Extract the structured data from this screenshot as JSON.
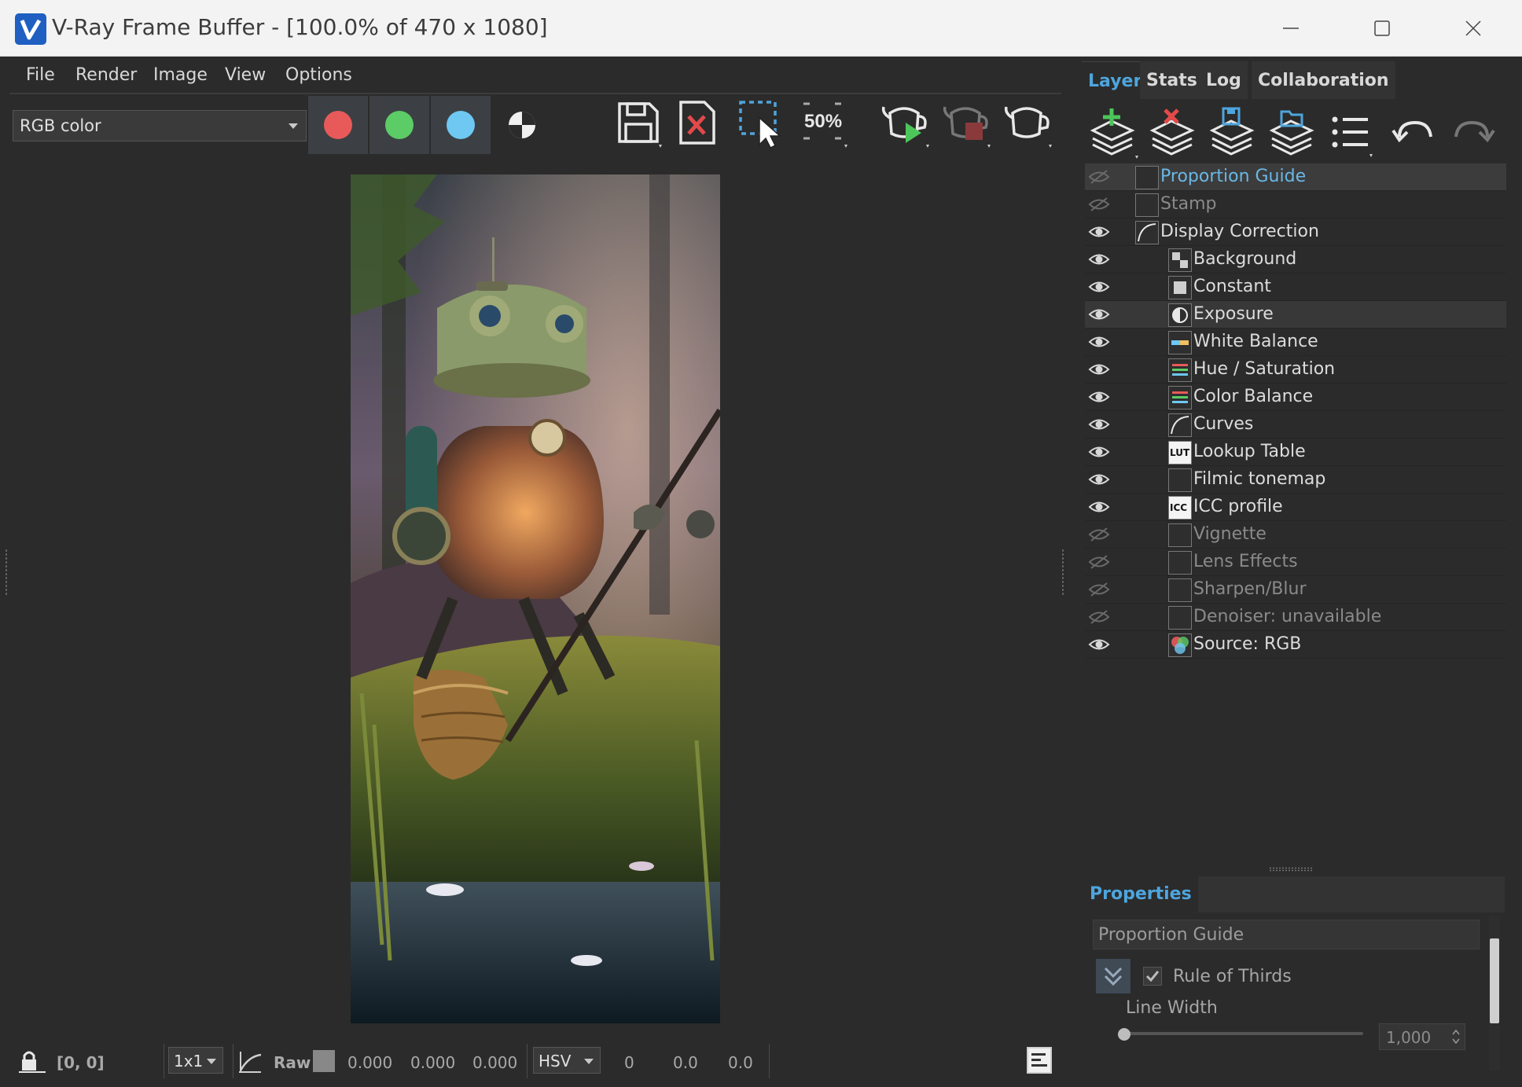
{
  "window": {
    "title": "V-Ray Frame Buffer - [100.0% of 470 x 1080]"
  },
  "menu": [
    "File",
    "Render",
    "Image",
    "View",
    "Options"
  ],
  "toolbar": {
    "channel": "RGB color",
    "channel_swatches": [
      {
        "name": "red-channel",
        "color": "#e85a5a"
      },
      {
        "name": "green-channel",
        "color": "#5ccc66"
      },
      {
        "name": "blue-channel",
        "color": "#6ec8f2"
      }
    ],
    "zoom_label": "50%"
  },
  "tabs": [
    "Layers",
    "Stats",
    "Log",
    "Collaboration"
  ],
  "active_tab": "Layers",
  "layers": [
    {
      "name": "Proportion Guide",
      "visible": false,
      "indent": 0,
      "selected": true,
      "icon": "proportion-guide-icon"
    },
    {
      "name": "Stamp",
      "visible": false,
      "indent": 0,
      "icon": "stamp-icon"
    },
    {
      "name": "Display Correction",
      "visible": true,
      "indent": 0,
      "icon": "display-correction-icon"
    },
    {
      "name": "Background",
      "visible": true,
      "indent": 1,
      "icon": "background-icon"
    },
    {
      "name": "Constant",
      "visible": true,
      "indent": 1,
      "icon": "constant-icon"
    },
    {
      "name": "Exposure",
      "visible": true,
      "indent": 1,
      "hover": true,
      "icon": "exposure-icon"
    },
    {
      "name": "White Balance",
      "visible": true,
      "indent": 1,
      "icon": "white-balance-icon"
    },
    {
      "name": "Hue / Saturation",
      "visible": true,
      "indent": 1,
      "icon": "hue-saturation-icon"
    },
    {
      "name": "Color Balance",
      "visible": true,
      "indent": 1,
      "icon": "color-balance-icon"
    },
    {
      "name": "Curves",
      "visible": true,
      "indent": 1,
      "icon": "curves-icon"
    },
    {
      "name": "Lookup Table",
      "visible": true,
      "indent": 1,
      "icon": "lut-icon",
      "icon_text": "LUT"
    },
    {
      "name": "Filmic tonemap",
      "visible": true,
      "indent": 1,
      "icon": "filmic-tonemap-icon"
    },
    {
      "name": "ICC profile",
      "visible": true,
      "indent": 1,
      "icon": "icc-icon",
      "icon_text": "ICC"
    },
    {
      "name": "Vignette",
      "visible": false,
      "indent": 1,
      "icon": "vignette-icon"
    },
    {
      "name": "Lens Effects",
      "visible": false,
      "indent": 1,
      "icon": "lens-effects-icon"
    },
    {
      "name": "Sharpen/Blur",
      "visible": false,
      "indent": 1,
      "icon": "sharpen-blur-icon"
    },
    {
      "name": "Denoiser: unavailable",
      "visible": false,
      "indent": 1,
      "icon": "denoiser-icon"
    },
    {
      "name": "Source: RGB",
      "visible": true,
      "indent": 1,
      "icon": "source-rgb-icon"
    }
  ],
  "properties": {
    "header": "Properties",
    "title": "Proportion Guide",
    "rule_of_thirds": {
      "label": "Rule of Thirds",
      "checked": true
    },
    "line_width": {
      "label": "Line Width",
      "value": "1,000",
      "level": 0.0
    }
  },
  "status": {
    "coords": "[0, 0]",
    "sampling": "1x1",
    "raw_label": "Raw",
    "rgb": [
      "0.000",
      "0.000",
      "0.000"
    ],
    "color_mode": "HSV",
    "hsv": [
      "0",
      "0.0",
      "0.0"
    ]
  }
}
